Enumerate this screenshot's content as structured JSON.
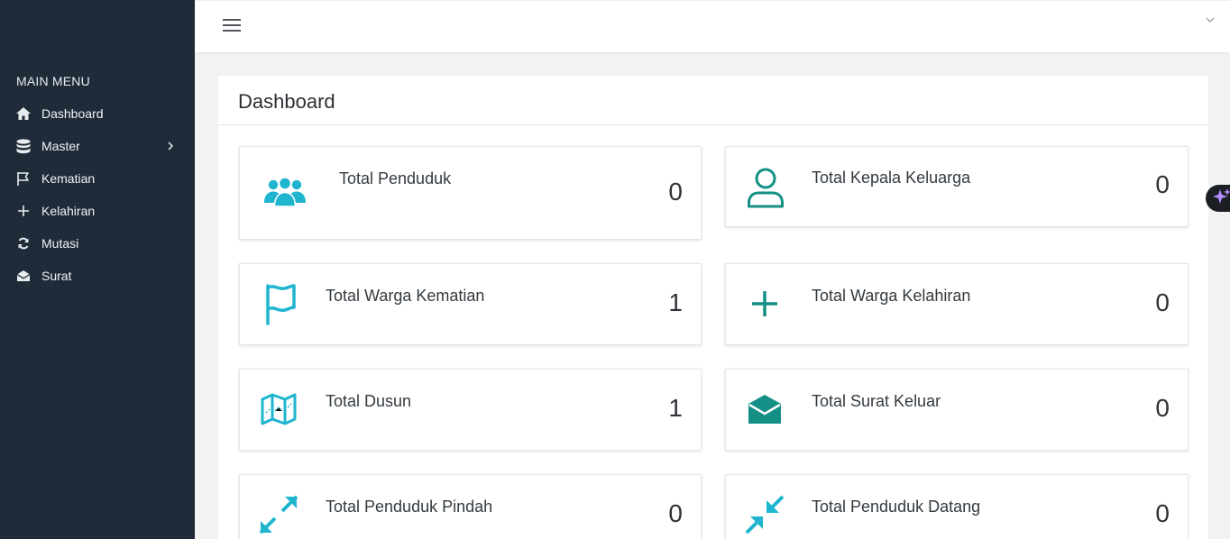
{
  "sidebar": {
    "heading": "MAIN MENU",
    "items": [
      {
        "label": "Dashboard",
        "icon": "home-icon"
      },
      {
        "label": "Master",
        "icon": "database-icon"
      },
      {
        "label": "Kematian",
        "icon": "flag-icon"
      },
      {
        "label": "Kelahiran",
        "icon": "plus-icon"
      },
      {
        "label": "Mutasi",
        "icon": "refresh-icon"
      },
      {
        "label": "Surat",
        "icon": "envelope-open-icon"
      }
    ]
  },
  "panel": {
    "title": "Dashboard"
  },
  "cards": [
    {
      "label": "Total Penduduk",
      "value": "0",
      "icon": "users-icon"
    },
    {
      "label": "Total Kepala Keluarga",
      "value": "0",
      "icon": "user-icon"
    },
    {
      "label": "Total Warga Kematian",
      "value": "1",
      "icon": "flag-icon"
    },
    {
      "label": "Total Warga Kelahiran",
      "value": "0",
      "icon": "plus-icon"
    },
    {
      "label": "Total Dusun",
      "value": "1",
      "icon": "map-icon"
    },
    {
      "label": "Total Surat Keluar",
      "value": "0",
      "icon": "envelope-open-icon"
    },
    {
      "label": "Total Penduduk Pindah",
      "value": "0",
      "icon": "expand-arrows-icon"
    },
    {
      "label": "Total Penduduk Datang",
      "value": "0",
      "icon": "compress-arrows-icon"
    }
  ],
  "colors": {
    "sidebar_bg": "#1f2b38",
    "accent_cyan": "#1fb5cf",
    "accent_teal": "#138f86"
  }
}
